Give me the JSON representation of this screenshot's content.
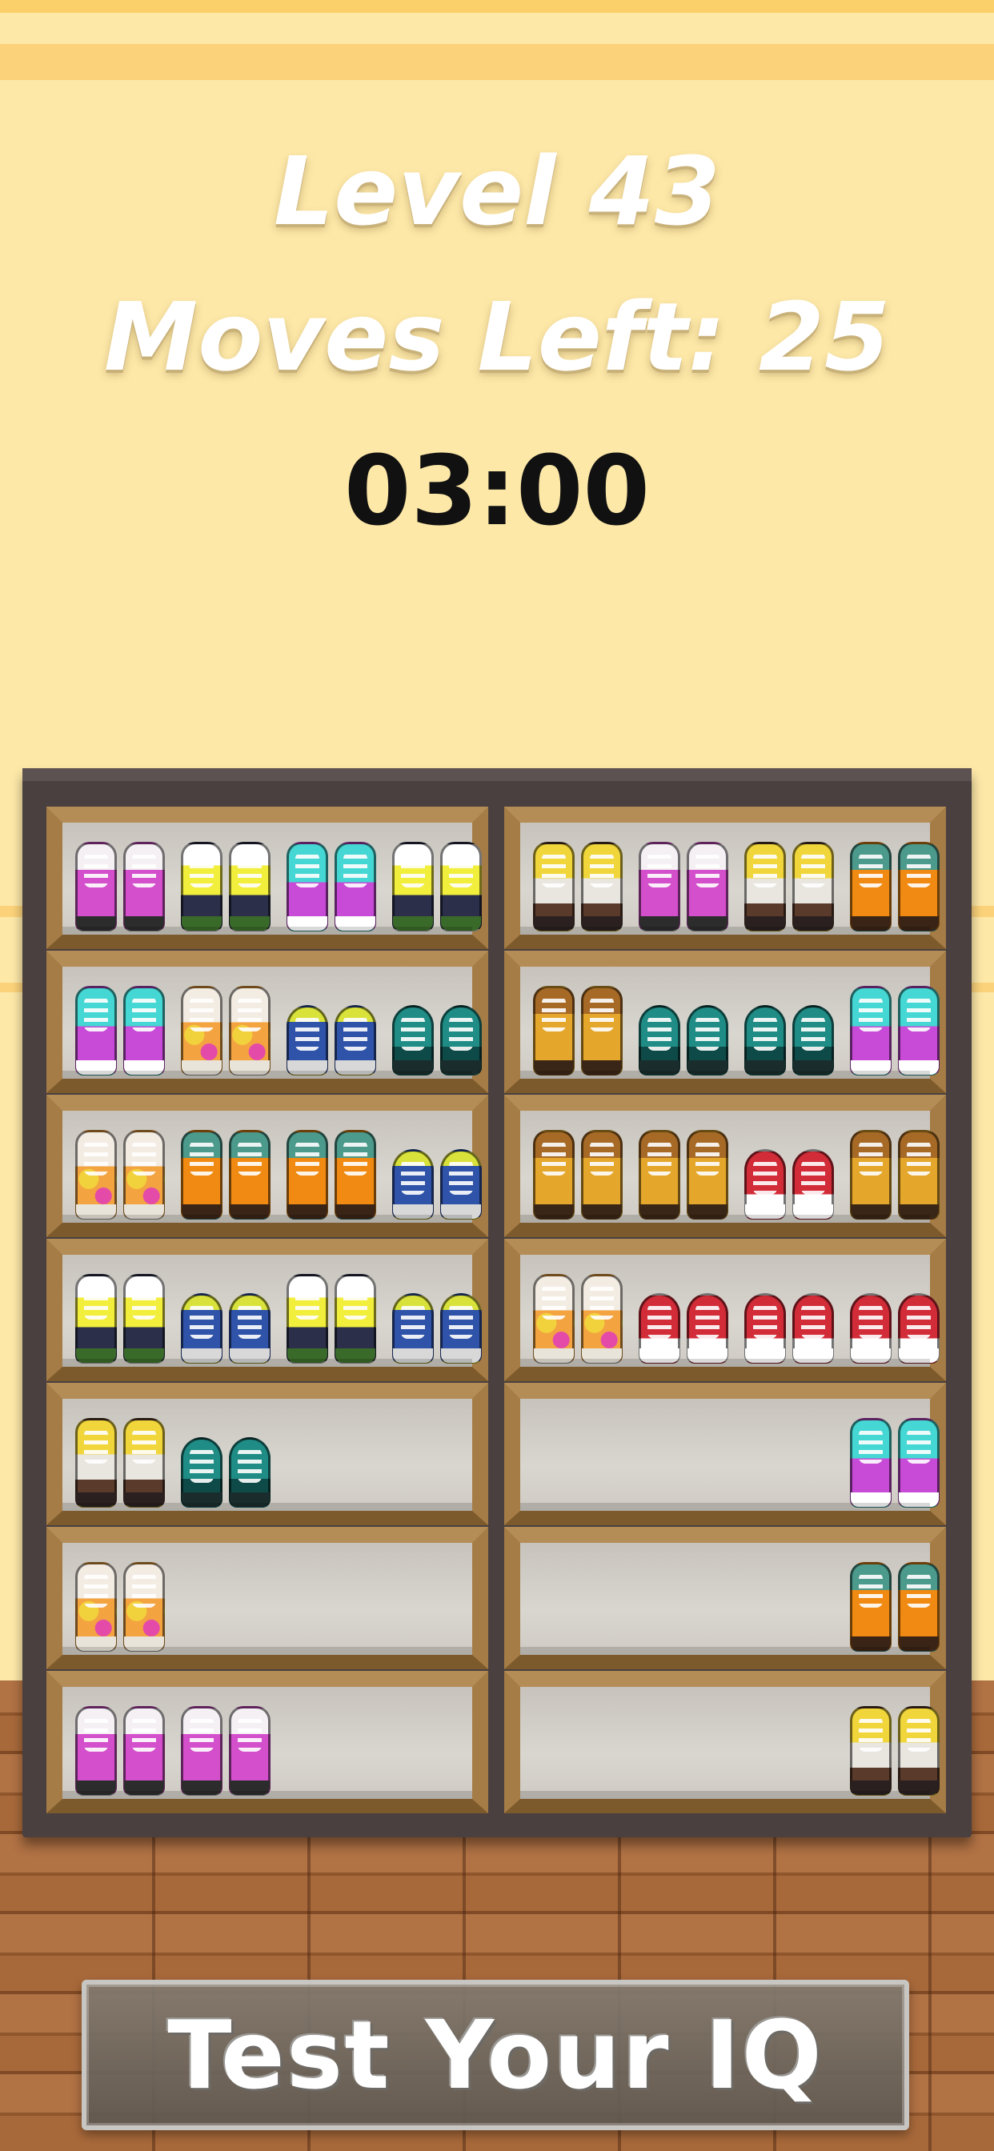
{
  "header": {
    "level_text": "Level 43",
    "moves_text": "Moves Left: 25",
    "timer_text": "03:00"
  },
  "shelf": {
    "left_column": [
      [
        "pink",
        "yellow",
        "cyan",
        "yellow"
      ],
      [
        "cyan",
        "graffiti",
        "blue",
        "teal"
      ],
      [
        "graffiti",
        "orange",
        "orange",
        "blue"
      ],
      [
        "yellow",
        "blue",
        "yellow",
        "blue"
      ],
      [
        "brownyellow",
        "teal"
      ],
      [
        "graffiti"
      ],
      [
        "pink",
        "pink"
      ]
    ],
    "right_column": [
      [
        "brownyellow",
        "pink",
        "brownyellow",
        "orange"
      ],
      [
        "boot",
        "teal",
        "teal",
        "cyan"
      ],
      [
        "boot",
        "boot",
        "red",
        "boot"
      ],
      [
        "graffiti",
        "red",
        "red",
        "red"
      ],
      [
        "cyan"
      ],
      [
        "orange"
      ],
      [
        "brownyellow"
      ]
    ]
  },
  "button": {
    "label": "Test Your IQ"
  },
  "colors": {
    "wall": "#fde8a8",
    "shelf_frame": "#4a4040",
    "wood_trim": "#a57c46",
    "floor": "#a8693a"
  }
}
